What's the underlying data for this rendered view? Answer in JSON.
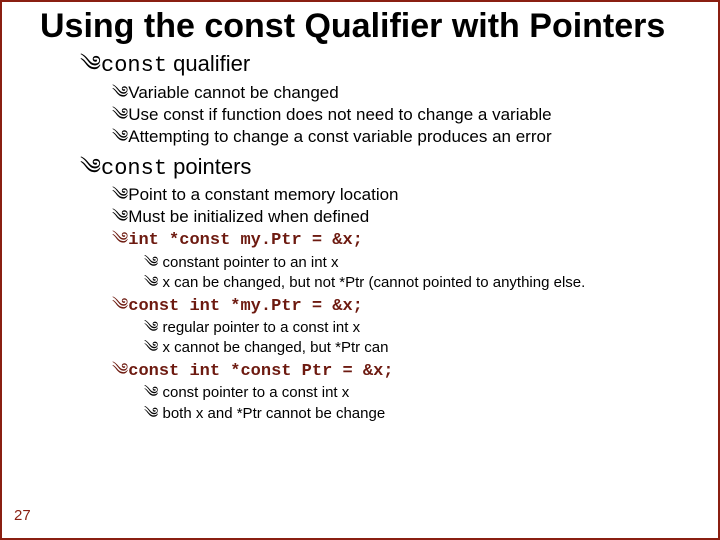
{
  "bullet_prefix": "༄",
  "title": "Using the const Qualifier with Pointers",
  "s1": {
    "head_a": "const",
    "head_b": " qualifier",
    "p1": "Variable cannot be changed",
    "p2": "Use const if function does not need to change a variable",
    "p3": "Attempting to change a const variable produces an error"
  },
  "s2": {
    "head_a": "const",
    "head_b": " pointers",
    "p1": "Point to a constant memory location",
    "p2": "Must be initialized when defined",
    "code1": "int *const my.Ptr = &x;",
    "c1a": "constant pointer to an int x",
    "c1b": "x can be changed, but not *Ptr (cannot pointed to anything else.",
    "code2": "const int *my.Ptr = &x;",
    "c2a": "regular pointer to a const int x",
    "c2b": "x cannot be changed, but *Ptr can",
    "code3": "const int *const Ptr = &x;",
    "c3a": "const pointer to a const int x",
    "c3b": "both x and *Ptr cannot be change"
  },
  "page_number": "27"
}
